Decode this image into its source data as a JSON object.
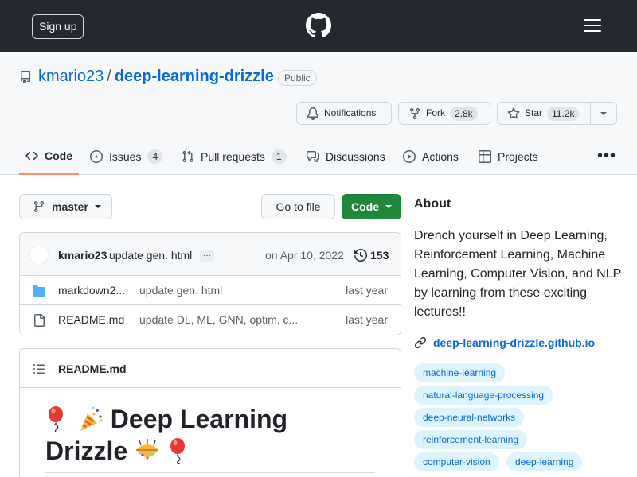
{
  "header": {
    "signup_label": "Sign up"
  },
  "repo": {
    "owner": "kmario23",
    "separator": "/",
    "name": "deep-learning-drizzle",
    "visibility": "Public",
    "notifications_label": "Notifications",
    "fork_label": "Fork",
    "fork_count": "2.8k",
    "star_label": "Star",
    "star_count": "11.2k"
  },
  "tabs": [
    {
      "label": "Code",
      "icon": "code-icon",
      "selected": true
    },
    {
      "label": "Issues",
      "icon": "issue-icon",
      "count": "4"
    },
    {
      "label": "Pull requests",
      "icon": "pull-request-icon",
      "count": "1"
    },
    {
      "label": "Discussions",
      "icon": "discussions-icon"
    },
    {
      "label": "Actions",
      "icon": "play-icon"
    },
    {
      "label": "Projects",
      "icon": "table-icon"
    }
  ],
  "toolbar": {
    "branch": "master",
    "go_to_file": "Go to file",
    "code_button": "Code"
  },
  "commit": {
    "author": "kmario23",
    "message": "update gen. html",
    "ellipsis": "…",
    "date": "on Apr 10, 2022",
    "count": "153"
  },
  "files": [
    {
      "name": "markdown2...",
      "type": "folder",
      "message": "update gen. html",
      "date": "last year"
    },
    {
      "name": "README.md",
      "type": "file",
      "message": "update DL, ML, GNN, optim. c...",
      "date": "last year"
    }
  ],
  "readme": {
    "header_label": "README.md",
    "title_line1": "Deep Learning",
    "title_line2": "Drizzle"
  },
  "about": {
    "heading": "About",
    "description": "Drench yourself in Deep Learning, Reinforcement Learning, Machine Learning, Computer Vision, and NLP by learning from these exciting lectures!!",
    "homepage": "deep-learning-drizzle.github.io",
    "topics": [
      "machine-learning",
      "natural-language-processing",
      "deep-neural-networks",
      "reinforcement-learning",
      "computer-vision",
      "deep-learning"
    ]
  },
  "colors": {
    "header_bg": "#24292f",
    "link": "#0969da",
    "code_button": "#1f883d",
    "selected_tab_underline": "#fd8c73",
    "topic_bg": "#ddf4ff"
  }
}
